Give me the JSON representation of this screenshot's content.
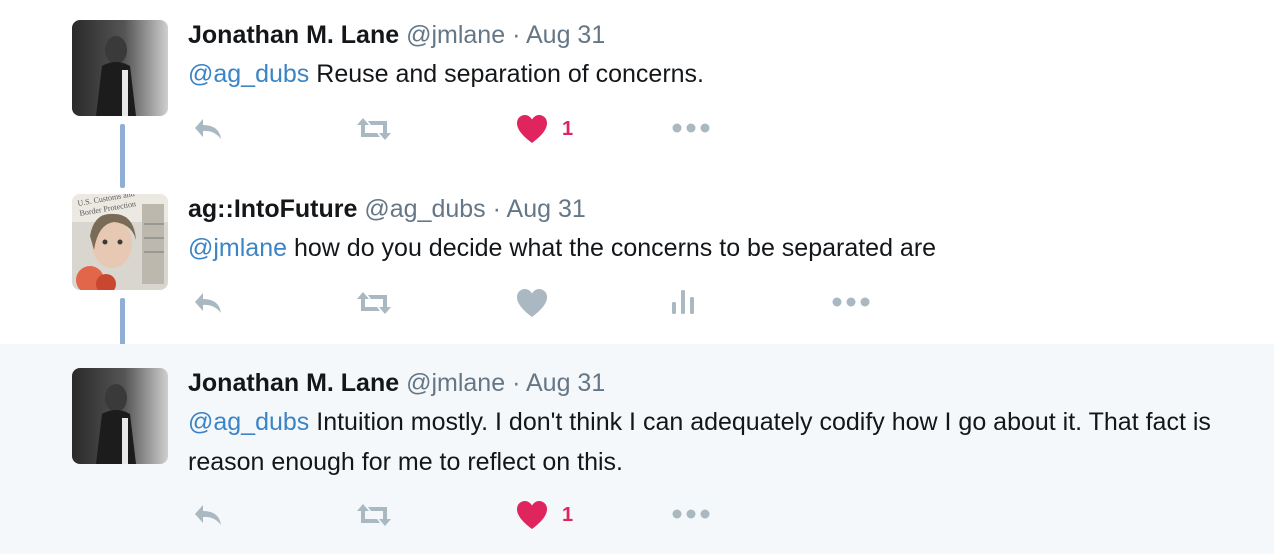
{
  "tweets": [
    {
      "name": "Jonathan M. Lane",
      "handle": "@jmlane",
      "separator": "·",
      "time": "Aug 31",
      "mention": "@ag_dubs",
      "text": " Reuse and separation of concerns.",
      "like_count": "1",
      "liked": true
    },
    {
      "name": "ag::IntoFuture",
      "handle": "@ag_dubs",
      "separator": "·",
      "time": "Aug 31",
      "mention": "@jmlane",
      "text": " how do you decide what the concerns to be separated are",
      "liked": false
    },
    {
      "name": "Jonathan M. Lane",
      "handle": "@jmlane",
      "separator": "·",
      "time": "Aug 31",
      "mention": "@ag_dubs",
      "text": " Intuition mostly. I don't think I can adequately codify how I go about it. That fact is reason enough for me to reflect on this.",
      "like_count": "1",
      "liked": true
    }
  ],
  "avatar_badge_text": "U.S. Customs and Border Protection",
  "icons": {
    "reply": "reply-icon",
    "retweet": "retweet-icon",
    "like": "heart-icon",
    "analytics": "analytics-icon",
    "more": "more-icon"
  },
  "colors": {
    "action_gray": "#aab8c2",
    "like_red": "#e0245e",
    "mention_blue": "#3b84c6",
    "thread_line": "#8fb0d4",
    "highlight_bg": "#f5f8fa"
  }
}
